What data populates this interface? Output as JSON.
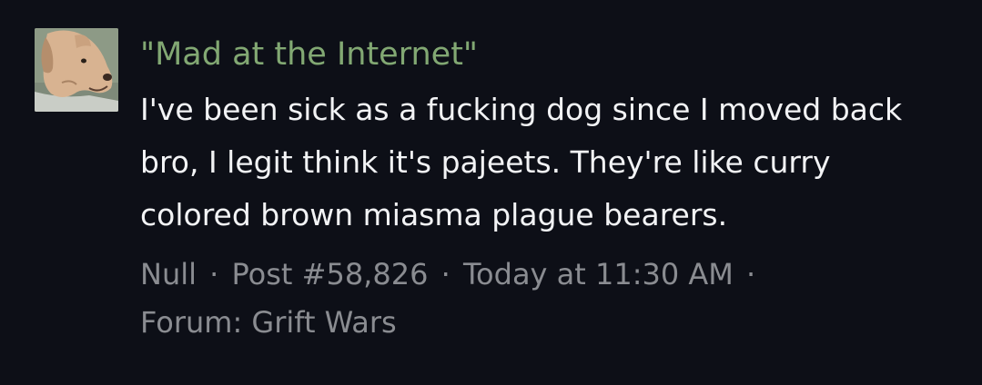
{
  "result": {
    "avatar_icon": "dog-avatar-icon",
    "title": "\"Mad at the Internet\"",
    "snippet": "I've been sick as a fucking dog since I moved back bro, I legit think it's pajeets. They're like curry colored brown miasma plague bearers.",
    "meta": {
      "author": "Null",
      "separator": "·",
      "post": "Post #58,826",
      "time": "Today at 11:30 AM",
      "forum": "Forum: Grift Wars"
    }
  },
  "colors": {
    "background": "#0d0f17",
    "title": "#82a873",
    "text": "#f2f3f5",
    "meta": "#8a8c91"
  }
}
